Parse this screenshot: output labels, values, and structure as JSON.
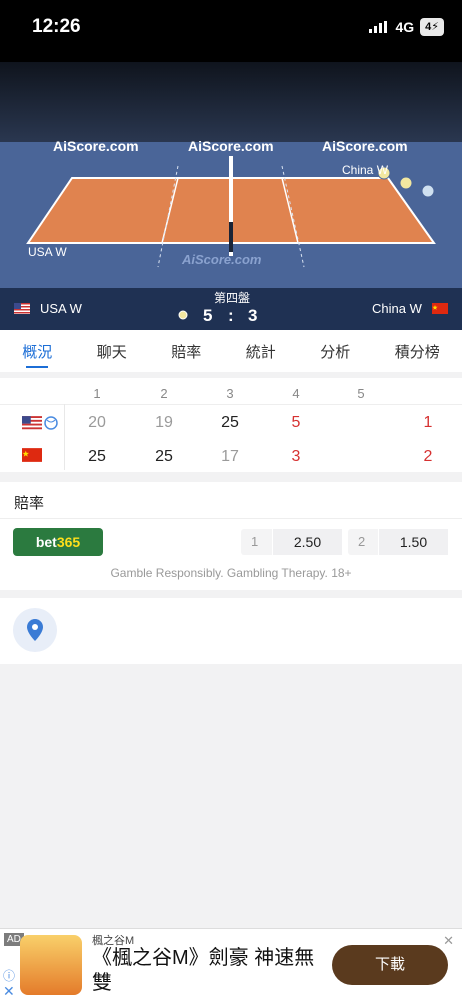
{
  "status_bar": {
    "time": "12:26",
    "network": "4G",
    "battery": "4"
  },
  "court": {
    "ad_texts": [
      "AiScore.com",
      "AiScore.com",
      "AiScore.com"
    ],
    "ad_floor": "AiScore.com",
    "label_left": "USA W",
    "label_right": "China W"
  },
  "scoreboard": {
    "home_name": "USA W",
    "away_name": "China W",
    "set_label": "第四盤",
    "home_score": "5",
    "separator": ":",
    "away_score": "3"
  },
  "tabs": [
    "概況",
    "聊天",
    "賠率",
    "統計",
    "分析",
    "積分榜"
  ],
  "set_table": {
    "headers": [
      "1",
      "2",
      "3",
      "4",
      "5"
    ],
    "home": {
      "sets": [
        "20",
        "19",
        "25",
        "5",
        ""
      ],
      "total": "1"
    },
    "away": {
      "sets": [
        "25",
        "25",
        "17",
        "3",
        ""
      ],
      "total": "2"
    }
  },
  "odds": {
    "title": "賠率",
    "bookmaker_a": "bet",
    "bookmaker_b": "365",
    "opt1_key": "1",
    "opt1_val": "2.50",
    "opt2_key": "2",
    "opt2_val": "1.50",
    "note": "Gamble Responsibly. Gambling Therapy. 18+"
  },
  "ad": {
    "tag": "AD",
    "brand": "楓之谷M",
    "headline": "《楓之谷M》劍豪 神速無雙",
    "download": "下載",
    "close": "✕",
    "info": "ⓘ"
  },
  "colors": {
    "accent": "#1c6ed6",
    "score_bar": "#1f3153",
    "red": "#d63131",
    "bet365_green": "#2b7a3f"
  }
}
